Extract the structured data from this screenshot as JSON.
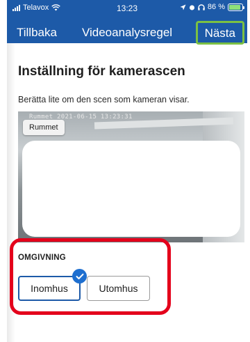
{
  "status_bar": {
    "carrier": "Telavox",
    "time": "13:23",
    "battery": "86 %",
    "battery_level": 0.86,
    "icons": [
      "signal-icon",
      "wifi-icon",
      "location-icon",
      "alarm-icon",
      "headphones-icon",
      "battery-icon"
    ]
  },
  "nav": {
    "back_label": "Tillbaka",
    "title": "Videoanalysregel",
    "next_label": "Nästa"
  },
  "page": {
    "title": "Inställning för kamerascen",
    "subtitle": "Berätta lite om den scen som kameran visar."
  },
  "camera": {
    "timestamp": "Rummet  2021-06-15 13:23:31",
    "room_label": "Rummet"
  },
  "environment": {
    "label": "OMGIVNING",
    "options": [
      {
        "label": "Inomhus",
        "selected": true
      },
      {
        "label": "Utomhus",
        "selected": false
      }
    ]
  },
  "colors": {
    "header": "#1d5aa8",
    "accent": "#1e6fd0",
    "highlight_green": "#7bc043",
    "highlight_red": "#e4001b"
  }
}
